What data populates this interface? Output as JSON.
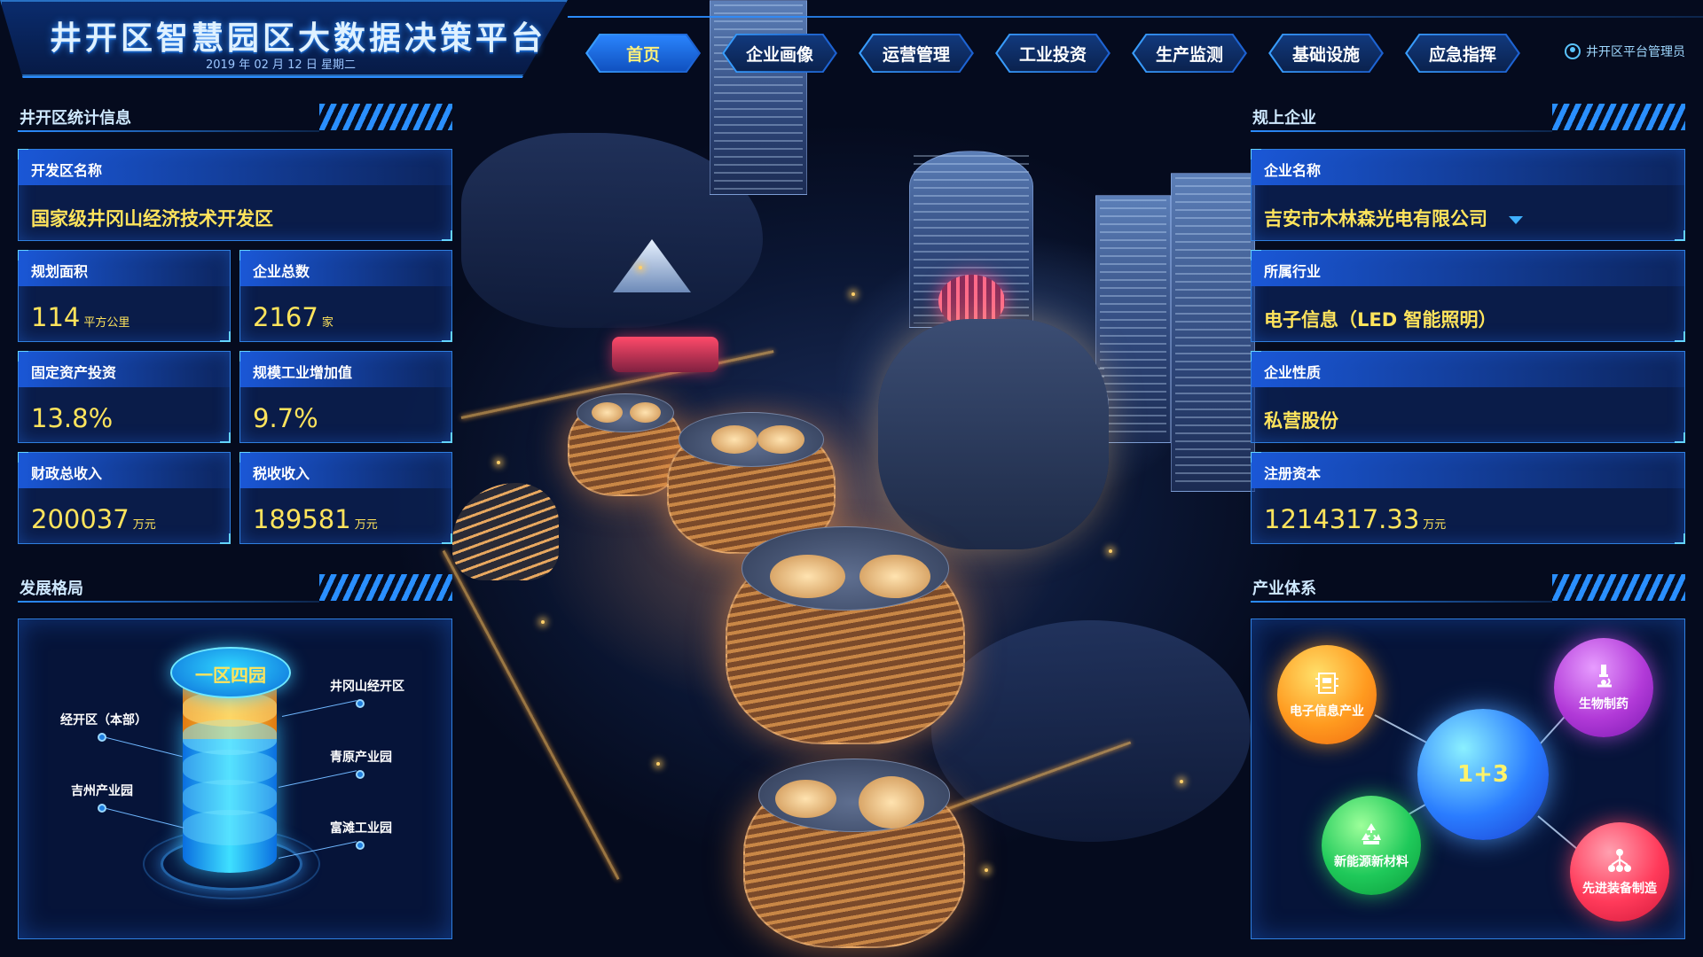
{
  "header": {
    "title": "井开区智慧园区大数据决策平台",
    "date": "2019 年 02 月 12 日  星期二",
    "user": "井开区平台管理员"
  },
  "nav": [
    "首页",
    "企业画像",
    "运营管理",
    "工业投资",
    "生产监测",
    "基础设施",
    "应急指挥"
  ],
  "nav_active": "首页",
  "stats": {
    "section_title": "井开区统计信息",
    "zone_name_label": "开发区名称",
    "zone_name_value": "国家级井冈山经济技术开发区",
    "area_label": "规划面积",
    "area_value": "114",
    "area_unit": "平方公里",
    "company_count_label": "企业总数",
    "company_count_value": "2167",
    "company_count_unit": "家",
    "fixed_asset_label": "固定资产投资",
    "fixed_asset_value": "13.8%",
    "industrial_label": "规模工业增加值",
    "industrial_value": "9.7%",
    "fiscal_label": "财政总收入",
    "fiscal_value": "200037",
    "fiscal_unit": "万元",
    "tax_label": "税收收入",
    "tax_value": "189581",
    "tax_unit": "万元"
  },
  "layout_section": {
    "title": "发展格局",
    "center_label": "一区四园",
    "parks": [
      "井冈山经开区",
      "经开区（本部）",
      "青原产业园",
      "吉州产业园",
      "富滩工业园"
    ]
  },
  "enterprise": {
    "section_title": "规上企业",
    "name_label": "企业名称",
    "name_value": "吉安市木林森光电有限公司",
    "industry_label": "所属行业",
    "industry_value": "电子信息（LED 智能照明）",
    "nature_label": "企业性质",
    "nature_value": "私营股份",
    "capital_label": "注册资本",
    "capital_value": "1214317.33",
    "capital_unit": "万元"
  },
  "industry": {
    "section_title": "产业体系",
    "center": "1+3",
    "items": {
      "electronics": "电子信息产业",
      "bio": "生物制药",
      "energy": "新能源新材料",
      "equipment": "先进装备制造"
    },
    "colors": {
      "electronics": "#ff9a1f",
      "bio": "#b23ad8",
      "energy": "#1fc95a",
      "equipment": "#ff3a5a",
      "center": "#2a7cff"
    },
    "icons": {
      "electronics": "chip-icon",
      "bio": "microscope-icon",
      "energy": "recycle-icon",
      "equipment": "network-icon"
    }
  }
}
